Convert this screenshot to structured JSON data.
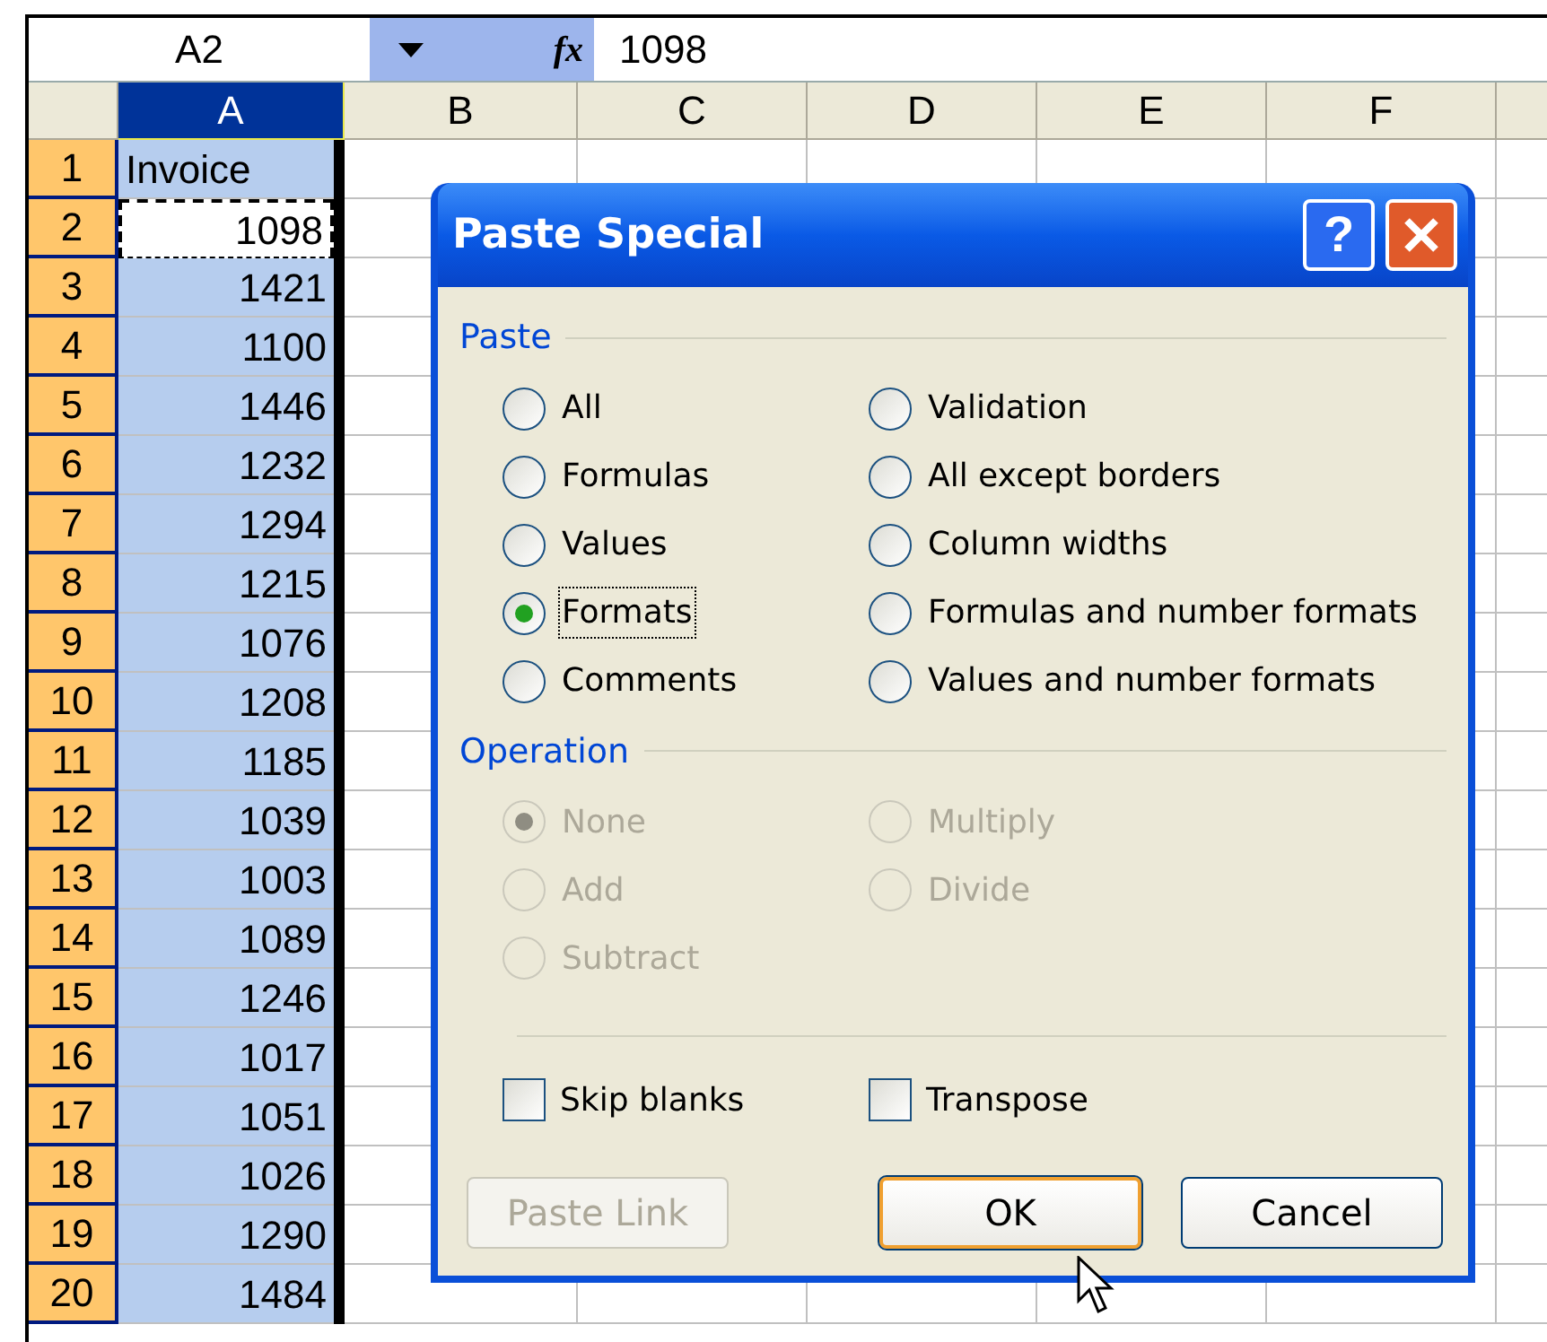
{
  "formula_bar": {
    "name_box": "A2",
    "fx": "fx",
    "value": "1098"
  },
  "columns": [
    {
      "label": "A",
      "selected": true
    },
    {
      "label": "B",
      "selected": false
    },
    {
      "label": "C",
      "selected": false
    },
    {
      "label": "D",
      "selected": false
    },
    {
      "label": "E",
      "selected": false
    },
    {
      "label": "F",
      "selected": false
    }
  ],
  "rows": [
    {
      "number": "1",
      "value": "Invoice",
      "kind": "text",
      "selected": true,
      "active": false
    },
    {
      "number": "2",
      "value": "1098",
      "kind": "number",
      "selected": true,
      "active": true
    },
    {
      "number": "3",
      "value": "1421",
      "kind": "number",
      "selected": true,
      "active": false
    },
    {
      "number": "4",
      "value": "1100",
      "kind": "number",
      "selected": true,
      "active": false
    },
    {
      "number": "5",
      "value": "1446",
      "kind": "number",
      "selected": true,
      "active": false
    },
    {
      "number": "6",
      "value": "1232",
      "kind": "number",
      "selected": true,
      "active": false
    },
    {
      "number": "7",
      "value": "1294",
      "kind": "number",
      "selected": true,
      "active": false
    },
    {
      "number": "8",
      "value": "1215",
      "kind": "number",
      "selected": true,
      "active": false
    },
    {
      "number": "9",
      "value": "1076",
      "kind": "number",
      "selected": true,
      "active": false
    },
    {
      "number": "10",
      "value": "1208",
      "kind": "number",
      "selected": true,
      "active": false
    },
    {
      "number": "11",
      "value": "1185",
      "kind": "number",
      "selected": true,
      "active": false
    },
    {
      "number": "12",
      "value": "1039",
      "kind": "number",
      "selected": true,
      "active": false
    },
    {
      "number": "13",
      "value": "1003",
      "kind": "number",
      "selected": true,
      "active": false
    },
    {
      "number": "14",
      "value": "1089",
      "kind": "number",
      "selected": true,
      "active": false
    },
    {
      "number": "15",
      "value": "1246",
      "kind": "number",
      "selected": true,
      "active": false
    },
    {
      "number": "16",
      "value": "1017",
      "kind": "number",
      "selected": true,
      "active": false
    },
    {
      "number": "17",
      "value": "1051",
      "kind": "number",
      "selected": true,
      "active": false
    },
    {
      "number": "18",
      "value": "1026",
      "kind": "number",
      "selected": true,
      "active": false
    },
    {
      "number": "19",
      "value": "1290",
      "kind": "number",
      "selected": true,
      "active": false
    },
    {
      "number": "20",
      "value": "1484",
      "kind": "number",
      "selected": true,
      "active": false
    }
  ],
  "dialog": {
    "title": "Paste Special",
    "help": "?",
    "paste": {
      "label": "Paste",
      "options": [
        {
          "label": "All",
          "selected": false,
          "disabled": false
        },
        {
          "label": "Formulas",
          "selected": false,
          "disabled": false
        },
        {
          "label": "Values",
          "selected": false,
          "disabled": false
        },
        {
          "label": "Formats",
          "selected": true,
          "disabled": false
        },
        {
          "label": "Comments",
          "selected": false,
          "disabled": false
        },
        {
          "label": "Validation",
          "selected": false,
          "disabled": false
        },
        {
          "label": "All except borders",
          "selected": false,
          "disabled": false
        },
        {
          "label": "Column widths",
          "selected": false,
          "disabled": false
        },
        {
          "label": "Formulas and number formats",
          "selected": false,
          "disabled": false
        },
        {
          "label": "Values and number formats",
          "selected": false,
          "disabled": false
        }
      ]
    },
    "operation": {
      "label": "Operation",
      "options": [
        {
          "label": "None",
          "selected": true,
          "disabled": true
        },
        {
          "label": "Add",
          "selected": false,
          "disabled": true
        },
        {
          "label": "Subtract",
          "selected": false,
          "disabled": true
        },
        {
          "label": "Multiply",
          "selected": false,
          "disabled": true
        },
        {
          "label": "Divide",
          "selected": false,
          "disabled": true
        }
      ]
    },
    "checkboxes": [
      {
        "label": "Skip blanks",
        "checked": false
      },
      {
        "label": "Transpose",
        "checked": false
      }
    ],
    "buttons": [
      {
        "label": "Paste Link",
        "disabled": true,
        "default": false
      },
      {
        "label": "OK",
        "disabled": false,
        "default": true
      },
      {
        "label": "Cancel",
        "disabled": false,
        "default": false
      }
    ]
  }
}
